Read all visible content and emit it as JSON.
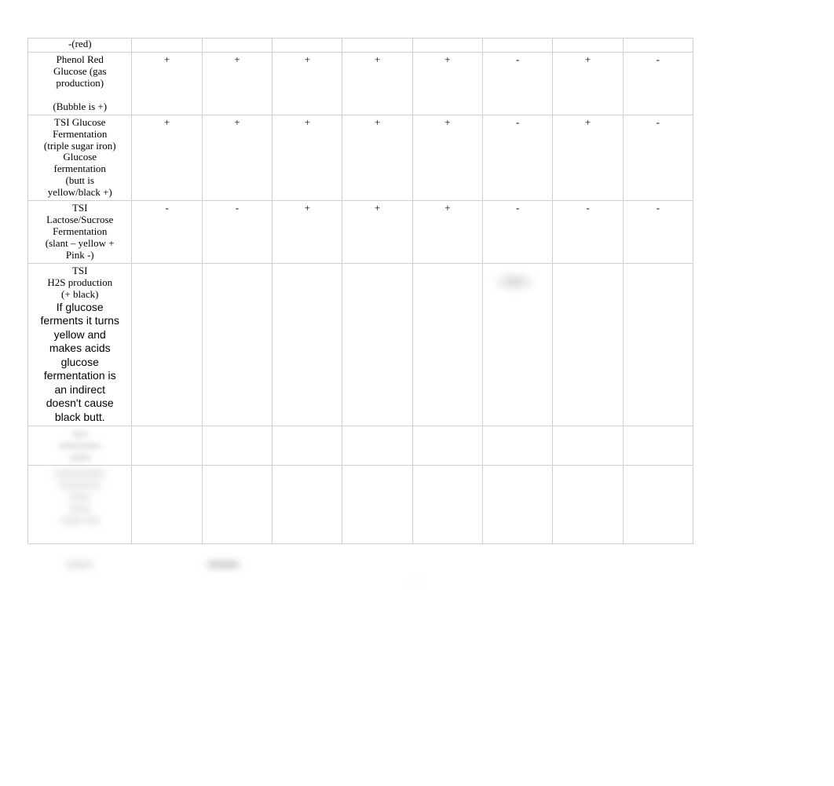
{
  "rows": [
    {
      "label": "-(red)",
      "cells": [
        "",
        "",
        "",
        "",
        "",
        "",
        "",
        ""
      ]
    },
    {
      "label": "Phenol Red\nGlucose (gas\nproduction)\n\n(Bubble is +)",
      "cells": [
        "+",
        "+",
        "+",
        "+",
        "+",
        "-",
        "+",
        "-"
      ]
    },
    {
      "label": "TSI  Glucose\nFermentation\n(triple sugar iron)\nGlucose\nfermentation\n(butt is\nyellow/black +)",
      "cells": [
        "+",
        "+",
        "+",
        "+",
        "+",
        "-",
        "+",
        "-"
      ]
    },
    {
      "label": "TSI\nLactose/Sucrose\nFermentation\n(slant – yellow +\nPink -)",
      "cells": [
        "-",
        "-",
        "+",
        "+",
        "+",
        "-",
        "-",
        "-"
      ]
    },
    {
      "label_line1": "TSI\nH2S production\n(+ black)",
      "label_line2": "If glucose\nferments it turns\nyellow and\nmakes acids\nglucose\nfermentation is\nan indirect\ndoesn't cause\nblack butt.",
      "cells": [
        "",
        "",
        "",
        "",
        "",
        "",
        "",
        ""
      ],
      "faint_col": 5
    }
  ],
  "blurred_rows": [
    {
      "label_placeholder": "xxx\nxxxxxxxx\nxxxx",
      "cells_placeholder": [
        "",
        "",
        "",
        "",
        "",
        "",
        "",
        ""
      ]
    },
    {
      "label_placeholder": "xxxxxxxxxx\nxxxxxxxx\nxxxx\nxxxx\nxxxx xxx",
      "cells_placeholder": [
        "",
        "",
        "",
        "",
        "",
        "",
        "",
        ""
      ]
    }
  ],
  "bottom_blur": {
    "left": "xxxxx",
    "mid": "xxxxxx",
    "dash": "- -"
  }
}
